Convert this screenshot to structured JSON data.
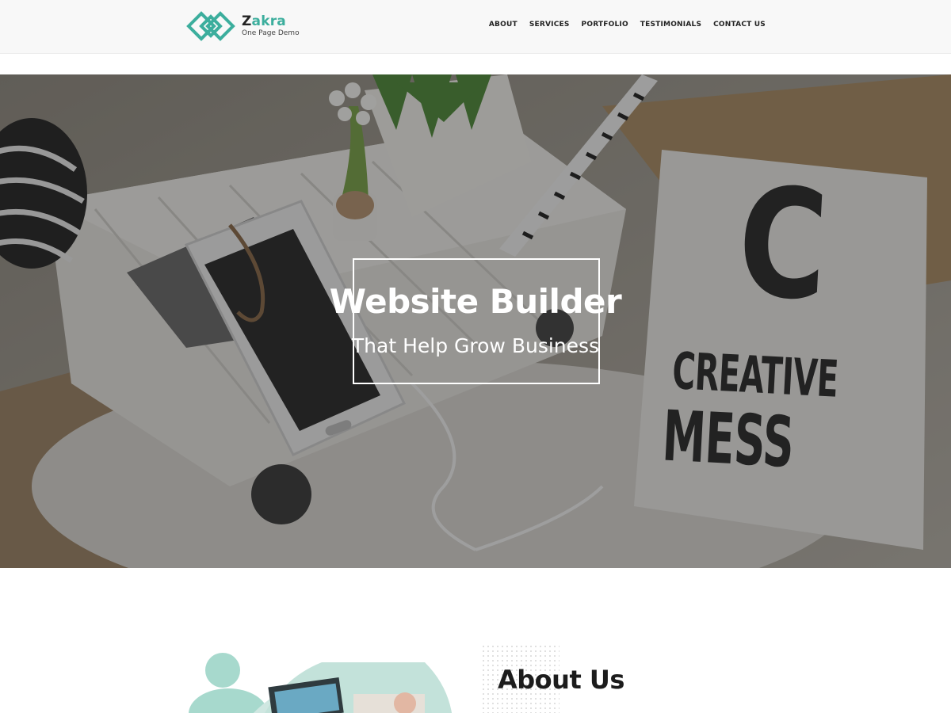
{
  "brand": {
    "name_first": "Z",
    "name_rest": "akra",
    "tagline": "One Page Demo",
    "accent_color": "#3cae9d"
  },
  "nav": {
    "items": [
      {
        "label": "ABOUT"
      },
      {
        "label": "SERVICES"
      },
      {
        "label": "PORTFOLIO"
      },
      {
        "label": "TESTIMONIALS"
      },
      {
        "label": "CONTACT US"
      }
    ]
  },
  "hero": {
    "title": "Website Builder",
    "subtitle": "That Help Grow Business",
    "image_text": {
      "letter": "C",
      "line1": "CREATIVE",
      "line2": "MESS"
    }
  },
  "about": {
    "title": "About Us"
  }
}
